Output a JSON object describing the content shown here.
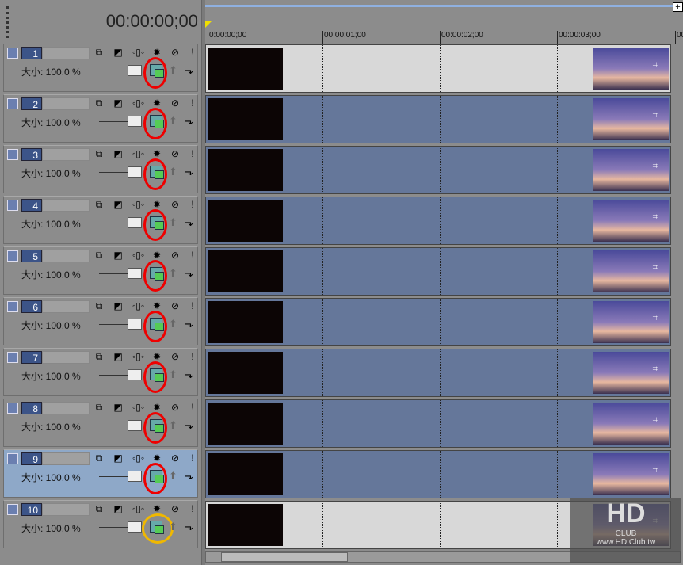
{
  "timecode": "00:00:00;00",
  "ruler": [
    "0:00:00;00",
    "00:00:01;00",
    "00:00:02;00",
    "00:00:03;00",
    "00"
  ],
  "size_label": "大小: 100.0 %",
  "tracks": [
    {
      "num": "1",
      "lane": "light",
      "circle": "red"
    },
    {
      "num": "2",
      "lane": "blue",
      "circle": "red"
    },
    {
      "num": "3",
      "lane": "blue",
      "circle": "red"
    },
    {
      "num": "4",
      "lane": "blue",
      "circle": "red"
    },
    {
      "num": "5",
      "lane": "blue",
      "circle": "red"
    },
    {
      "num": "6",
      "lane": "blue",
      "circle": "red"
    },
    {
      "num": "7",
      "lane": "blue",
      "circle": "red"
    },
    {
      "num": "8",
      "lane": "blue",
      "circle": "red"
    },
    {
      "num": "9",
      "lane": "blue",
      "circle": "red",
      "selected": true
    },
    {
      "num": "10",
      "lane": "light",
      "circle": "yellow"
    }
  ],
  "plus_label": "+",
  "watermark": {
    "logo": "HD",
    "sub": "CLUB",
    "url": "www.HD.Club.tw"
  }
}
